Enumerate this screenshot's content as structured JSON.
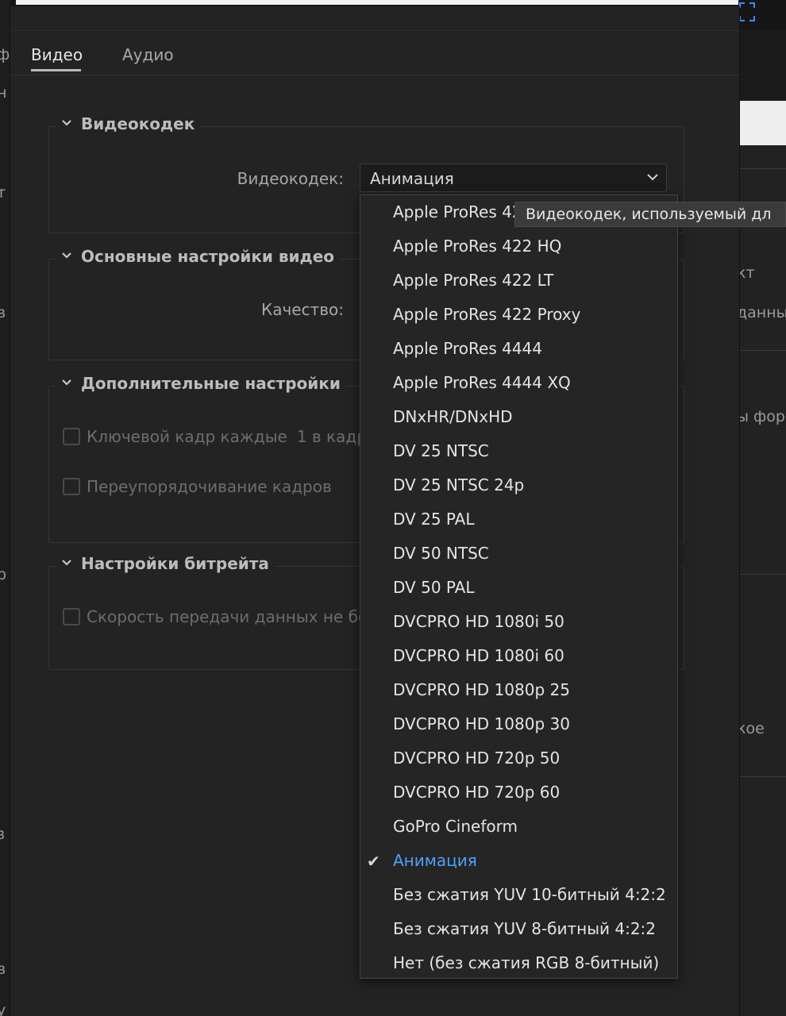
{
  "background": {
    "right_frags": [
      "кт",
      "данны",
      "ы фор",
      "кое"
    ],
    "left_frags": [
      "ф",
      "н",
      "т",
      "в",
      "р",
      "ı",
      "з",
      "в",
      "у"
    ]
  },
  "tabs": [
    {
      "label": "Видео",
      "active": true
    },
    {
      "label": "Аудио",
      "active": false
    }
  ],
  "groups": {
    "codec": {
      "title": "Видеокодек",
      "field_label": "Видеокодек:",
      "select_value": "Анимация"
    },
    "basic": {
      "title": "Основные настройки видео",
      "field_label": "Качество:"
    },
    "advanced": {
      "title": "Дополнительные настройки",
      "keyframe_label": "Ключевой кадр каждые",
      "keyframe_value": "1 в кадра",
      "reorder_label": "Переупорядочивание кадров"
    },
    "bitrate": {
      "title": "Настройки битрейта",
      "limit_label": "Скорость передачи данных не бол"
    }
  },
  "dropdown": {
    "items": [
      "Apple ProRes 422",
      "Apple ProRes 422 HQ",
      "Apple ProRes 422 LT",
      "Apple ProRes 422 Proxy",
      "Apple ProRes 4444",
      "Apple ProRes 4444 XQ",
      "DNxHR/DNxHD",
      "DV 25 NTSC",
      "DV 25 NTSC 24p",
      "DV 25 PAL",
      "DV 50 NTSC",
      "DV 50 PAL",
      "DVCPRO HD 1080i 50",
      "DVCPRO HD 1080i 60",
      "DVCPRO HD 1080p 25",
      "DVCPRO HD 1080p 30",
      "DVCPRO HD 720p 50",
      "DVCPRO HD 720p 60",
      "GoPro Cineform",
      "Анимация",
      "Без сжатия YUV 10-битный 4:2:2",
      "Без сжатия YUV 8-битный 4:2:2",
      "Нет (без сжатия RGB 8-битный)"
    ],
    "selected_index": 19,
    "selected_color": "#4aa3ff"
  },
  "tooltip": {
    "text": "Видеокодек, используемый дл"
  }
}
